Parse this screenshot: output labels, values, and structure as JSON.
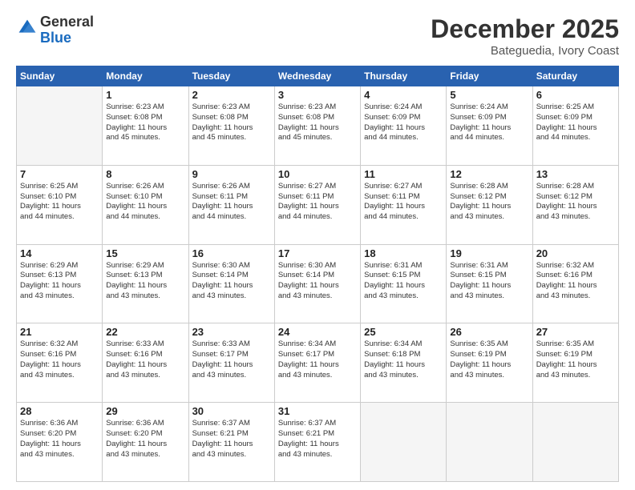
{
  "header": {
    "logo_general": "General",
    "logo_blue": "Blue",
    "month_title": "December 2025",
    "location": "Bateguedia, Ivory Coast"
  },
  "days_of_week": [
    "Sunday",
    "Monday",
    "Tuesday",
    "Wednesday",
    "Thursday",
    "Friday",
    "Saturday"
  ],
  "weeks": [
    [
      {
        "day": "",
        "info": ""
      },
      {
        "day": "1",
        "info": "Sunrise: 6:23 AM\nSunset: 6:08 PM\nDaylight: 11 hours\nand 45 minutes."
      },
      {
        "day": "2",
        "info": "Sunrise: 6:23 AM\nSunset: 6:08 PM\nDaylight: 11 hours\nand 45 minutes."
      },
      {
        "day": "3",
        "info": "Sunrise: 6:23 AM\nSunset: 6:08 PM\nDaylight: 11 hours\nand 45 minutes."
      },
      {
        "day": "4",
        "info": "Sunrise: 6:24 AM\nSunset: 6:09 PM\nDaylight: 11 hours\nand 44 minutes."
      },
      {
        "day": "5",
        "info": "Sunrise: 6:24 AM\nSunset: 6:09 PM\nDaylight: 11 hours\nand 44 minutes."
      },
      {
        "day": "6",
        "info": "Sunrise: 6:25 AM\nSunset: 6:09 PM\nDaylight: 11 hours\nand 44 minutes."
      }
    ],
    [
      {
        "day": "7",
        "info": "Sunrise: 6:25 AM\nSunset: 6:10 PM\nDaylight: 11 hours\nand 44 minutes."
      },
      {
        "day": "8",
        "info": "Sunrise: 6:26 AM\nSunset: 6:10 PM\nDaylight: 11 hours\nand 44 minutes."
      },
      {
        "day": "9",
        "info": "Sunrise: 6:26 AM\nSunset: 6:11 PM\nDaylight: 11 hours\nand 44 minutes."
      },
      {
        "day": "10",
        "info": "Sunrise: 6:27 AM\nSunset: 6:11 PM\nDaylight: 11 hours\nand 44 minutes."
      },
      {
        "day": "11",
        "info": "Sunrise: 6:27 AM\nSunset: 6:11 PM\nDaylight: 11 hours\nand 44 minutes."
      },
      {
        "day": "12",
        "info": "Sunrise: 6:28 AM\nSunset: 6:12 PM\nDaylight: 11 hours\nand 43 minutes."
      },
      {
        "day": "13",
        "info": "Sunrise: 6:28 AM\nSunset: 6:12 PM\nDaylight: 11 hours\nand 43 minutes."
      }
    ],
    [
      {
        "day": "14",
        "info": "Sunrise: 6:29 AM\nSunset: 6:13 PM\nDaylight: 11 hours\nand 43 minutes."
      },
      {
        "day": "15",
        "info": "Sunrise: 6:29 AM\nSunset: 6:13 PM\nDaylight: 11 hours\nand 43 minutes."
      },
      {
        "day": "16",
        "info": "Sunrise: 6:30 AM\nSunset: 6:14 PM\nDaylight: 11 hours\nand 43 minutes."
      },
      {
        "day": "17",
        "info": "Sunrise: 6:30 AM\nSunset: 6:14 PM\nDaylight: 11 hours\nand 43 minutes."
      },
      {
        "day": "18",
        "info": "Sunrise: 6:31 AM\nSunset: 6:15 PM\nDaylight: 11 hours\nand 43 minutes."
      },
      {
        "day": "19",
        "info": "Sunrise: 6:31 AM\nSunset: 6:15 PM\nDaylight: 11 hours\nand 43 minutes."
      },
      {
        "day": "20",
        "info": "Sunrise: 6:32 AM\nSunset: 6:16 PM\nDaylight: 11 hours\nand 43 minutes."
      }
    ],
    [
      {
        "day": "21",
        "info": "Sunrise: 6:32 AM\nSunset: 6:16 PM\nDaylight: 11 hours\nand 43 minutes."
      },
      {
        "day": "22",
        "info": "Sunrise: 6:33 AM\nSunset: 6:16 PM\nDaylight: 11 hours\nand 43 minutes."
      },
      {
        "day": "23",
        "info": "Sunrise: 6:33 AM\nSunset: 6:17 PM\nDaylight: 11 hours\nand 43 minutes."
      },
      {
        "day": "24",
        "info": "Sunrise: 6:34 AM\nSunset: 6:17 PM\nDaylight: 11 hours\nand 43 minutes."
      },
      {
        "day": "25",
        "info": "Sunrise: 6:34 AM\nSunset: 6:18 PM\nDaylight: 11 hours\nand 43 minutes."
      },
      {
        "day": "26",
        "info": "Sunrise: 6:35 AM\nSunset: 6:19 PM\nDaylight: 11 hours\nand 43 minutes."
      },
      {
        "day": "27",
        "info": "Sunrise: 6:35 AM\nSunset: 6:19 PM\nDaylight: 11 hours\nand 43 minutes."
      }
    ],
    [
      {
        "day": "28",
        "info": "Sunrise: 6:36 AM\nSunset: 6:20 PM\nDaylight: 11 hours\nand 43 minutes."
      },
      {
        "day": "29",
        "info": "Sunrise: 6:36 AM\nSunset: 6:20 PM\nDaylight: 11 hours\nand 43 minutes."
      },
      {
        "day": "30",
        "info": "Sunrise: 6:37 AM\nSunset: 6:21 PM\nDaylight: 11 hours\nand 43 minutes."
      },
      {
        "day": "31",
        "info": "Sunrise: 6:37 AM\nSunset: 6:21 PM\nDaylight: 11 hours\nand 43 minutes."
      },
      {
        "day": "",
        "info": ""
      },
      {
        "day": "",
        "info": ""
      },
      {
        "day": "",
        "info": ""
      }
    ]
  ]
}
